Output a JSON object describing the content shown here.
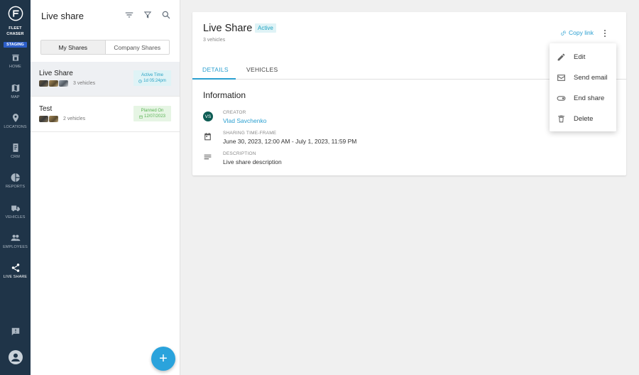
{
  "brand": {
    "line1": "FLEET",
    "line2": "CHASER",
    "env": "STAGING"
  },
  "nav": [
    {
      "label": "HOME",
      "icon": "home-icon"
    },
    {
      "label": "MAP",
      "icon": "map-icon"
    },
    {
      "label": "LOCATIONS",
      "icon": "location-pin-icon"
    },
    {
      "label": "CRM",
      "icon": "crm-icon"
    },
    {
      "label": "REPORTS",
      "icon": "pie-chart-icon"
    },
    {
      "label": "VEHICLES",
      "icon": "truck-icon"
    },
    {
      "label": "EMPLOYEES",
      "icon": "people-icon"
    },
    {
      "label": "LIVE SHARE",
      "icon": "share-icon",
      "active": true
    }
  ],
  "list": {
    "title": "Live share",
    "tabs": {
      "mine": "My Shares",
      "company": "Company Shares"
    },
    "items": [
      {
        "name": "Live Share",
        "vehicles": "3 vehicles",
        "badge_title": "Active Time",
        "badge_value": "1d 05:24pm"
      },
      {
        "name": "Test",
        "vehicles": "2 vehicles",
        "badge_title": "Planned On",
        "badge_value": "12/07/2023"
      }
    ],
    "fab": "+"
  },
  "detail": {
    "title": "Live Share",
    "status": "Active",
    "vehicle_count": "3 vehicles",
    "copy_link": "Copy link",
    "tabs": {
      "details": "DETAILS",
      "vehicles": "VEHICLES"
    },
    "info_title": "Information",
    "creator_label": "CREATOR",
    "creator_initials": "VS",
    "creator_name": "Vlad Savchenko",
    "timeframe_label": "SHARING TIME-FRAME",
    "timeframe_value": "June 30, 2023, 12:00 AM - July 1, 2023, 11:59 PM",
    "description_label": "DESCRIPTION",
    "description_value": "Live share description"
  },
  "menu": {
    "edit": "Edit",
    "send_email": "Send email",
    "end_share": "End share",
    "delete": "Delete"
  },
  "colors": {
    "accent": "#2aa3dc",
    "rail": "#1f3448",
    "active_badge": "#dff3f6",
    "planned_badge": "#e6f5e4"
  }
}
